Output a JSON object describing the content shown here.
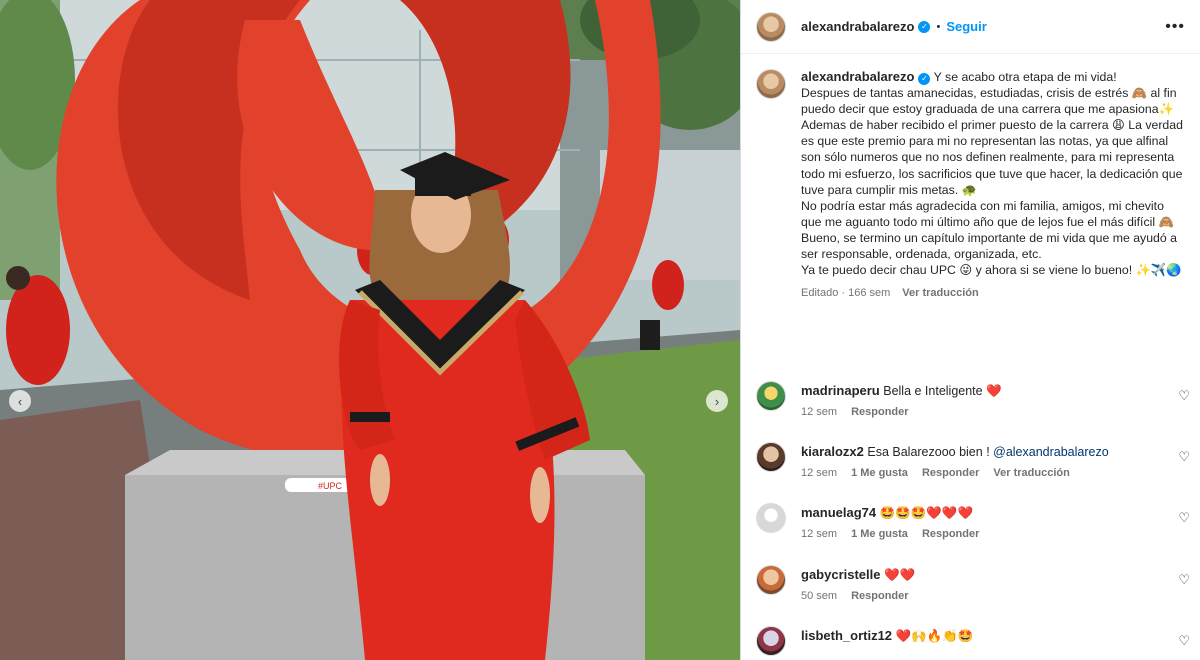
{
  "post": {
    "author": "alexandrabalarezo",
    "follow_label": "Seguir",
    "more_label": "•••",
    "verified_mark": "✓"
  },
  "photo": {
    "banner_text": "#UPC",
    "prev_arrow": "‹",
    "next_arrow": "›"
  },
  "caption": {
    "username": "alexandrabalarezo",
    "lines": [
      "Y se acabo otra etapa de mi vida!",
      "Despues de tantas amanecidas, estudiadas, crisis de estrés 🙈 al fin puedo decir que estoy graduada de una carrera que me apasiona✨",
      "Ademas de haber recibido el primer puesto de la carrera 😩 La verdad es que este premio para mi no representan las notas, ya que alfinal son sólo numeros que no nos definen realmente, para mi representa todo mi esfuerzo, los sacrificios que tuve que hacer, la dedicación que tuve para cumplir mis metas. 🐢",
      "No podría estar más agradecida con mi familia, amigos, mi chevito que me aguanto todo mi último año que de lejos fue el más difícil 🙈",
      "Bueno, se termino un capítulo importante de mi vida que me ayudó a ser responsable, ordenada, organizada, etc.",
      "Ya te puedo decir chau UPC 😜 y ahora si se viene lo bueno! ✨✈️🌏"
    ],
    "edited": "Editado · 166 sem",
    "see_translation": "Ver traducción"
  },
  "comments": [
    {
      "user": "madrinaperu",
      "text": "Bella e Inteligente",
      "emoji": "❤️",
      "time": "12 sem",
      "likes": "",
      "reply": "Responder",
      "translate": ""
    },
    {
      "user": "kiaralozx2",
      "text": "Esa Balarezooo bien ! ",
      "mention": "@alexandrabalarezo",
      "time": "12 sem",
      "likes": "1 Me gusta",
      "reply": "Responder",
      "translate": "Ver traducción"
    },
    {
      "user": "manuelag74",
      "text": "🤩🤩🤩",
      "emoji": "❤️❤️❤️",
      "time": "12 sem",
      "likes": "1 Me gusta",
      "reply": "Responder",
      "translate": ""
    },
    {
      "user": "gabycristelle",
      "text": "",
      "emoji": "❤️❤️",
      "time": "50 sem",
      "likes": "",
      "reply": "Responder",
      "translate": ""
    },
    {
      "user": "lisbeth_ortiz12",
      "text": "",
      "emoji": "❤️🙌🔥👏🤩",
      "time": "",
      "likes": "",
      "reply": "",
      "translate": ""
    }
  ],
  "icons": {
    "like_icon": "heart-outline",
    "verified_icon": "verified-badge",
    "more_icon": "ellipsis"
  },
  "colors": {
    "accent": "#0095f6",
    "gown_red": "#e02a1f",
    "sculpture_red": "#e2422c",
    "mention": "#00376b"
  }
}
